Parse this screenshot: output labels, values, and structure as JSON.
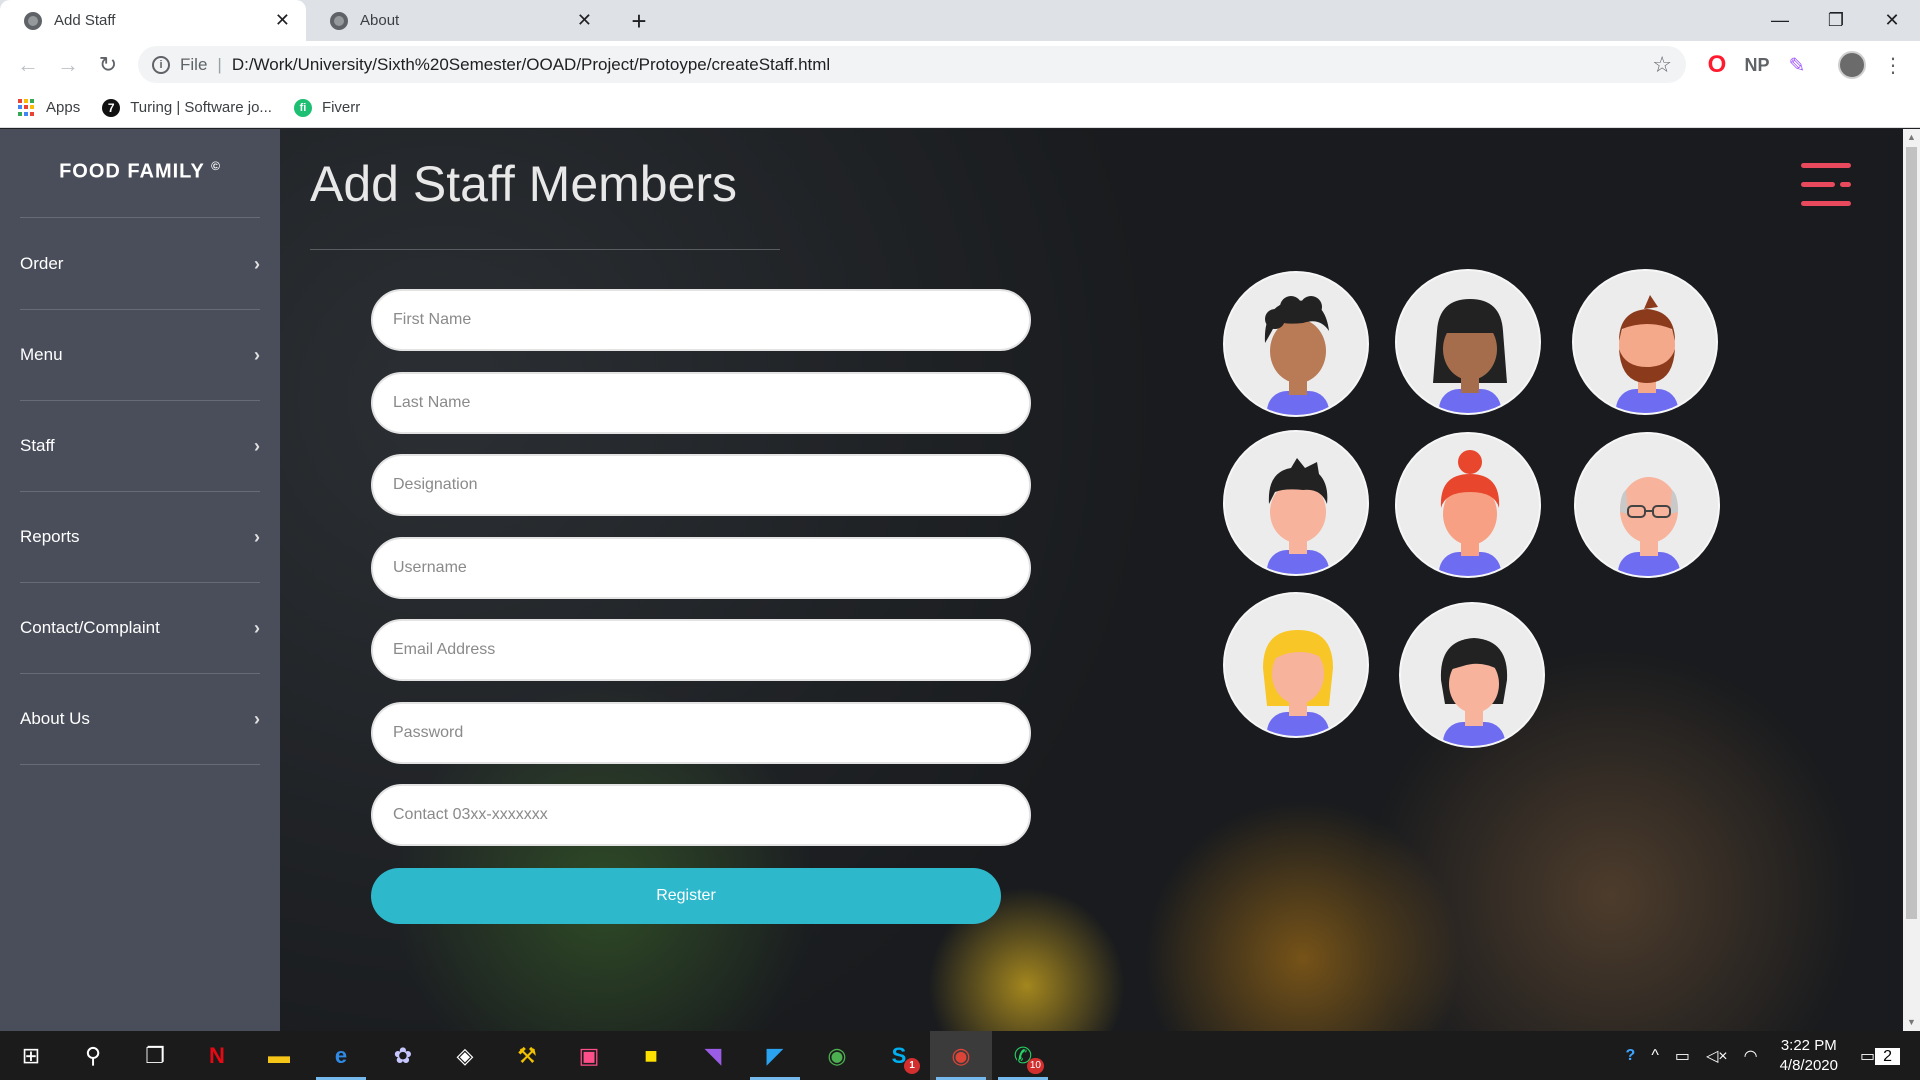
{
  "browser": {
    "tabs": [
      {
        "title": "Add Staff",
        "active": true
      },
      {
        "title": "About",
        "active": false
      }
    ],
    "newtab": "+",
    "url_scheme": "File",
    "url": "D:/Work/University/Sixth%20Semester/OOAD/Project/Protoype/createStaff.html",
    "extensions": {
      "np": "NP"
    },
    "bookmarks": [
      {
        "label": "Apps",
        "icon": "apps-grid-icon"
      },
      {
        "label": "Turing | Software jo...",
        "icon": "turing-icon"
      },
      {
        "label": "Fiverr",
        "icon": "fiverr-icon"
      }
    ]
  },
  "sidebar": {
    "brand": "FOOD FAMILY",
    "brand_mark": "©",
    "items": [
      {
        "label": "Order"
      },
      {
        "label": "Menu"
      },
      {
        "label": "Staff"
      },
      {
        "label": "Reports"
      },
      {
        "label": "Contact/Complaint"
      },
      {
        "label": "About Us"
      }
    ]
  },
  "main": {
    "title": "Add Staff Members",
    "form": {
      "first_name": {
        "placeholder": "First Name",
        "value": ""
      },
      "last_name": {
        "placeholder": "Last Name",
        "value": ""
      },
      "designation": {
        "placeholder": "Designation",
        "value": ""
      },
      "username": {
        "placeholder": "Username",
        "value": ""
      },
      "email": {
        "placeholder": "Email Address",
        "value": ""
      },
      "password": {
        "placeholder": "Password",
        "value": ""
      },
      "contact": {
        "placeholder": "Contact 03xx-xxxxxxx",
        "value": ""
      },
      "register_label": "Register"
    },
    "avatars": [
      {
        "name": "avatar-curly-hair-man"
      },
      {
        "name": "avatar-black-hair-woman"
      },
      {
        "name": "avatar-bearded-man"
      },
      {
        "name": "avatar-spiky-hair-boy"
      },
      {
        "name": "avatar-red-bun-woman"
      },
      {
        "name": "avatar-bald-glasses-man"
      },
      {
        "name": "avatar-blonde-woman"
      },
      {
        "name": "avatar-dark-bob-woman"
      }
    ],
    "colors": {
      "accent_register": "#2eb8cc",
      "hamburger": "#e8495c",
      "sidebar_bg": "#4a4e5a",
      "shirt": "#6e6cf0"
    }
  },
  "taskbar": {
    "badges": {
      "skype": "1",
      "whatsapp": "10",
      "notifications": "2"
    },
    "time": "3:22 PM",
    "date": "4/8/2020"
  }
}
